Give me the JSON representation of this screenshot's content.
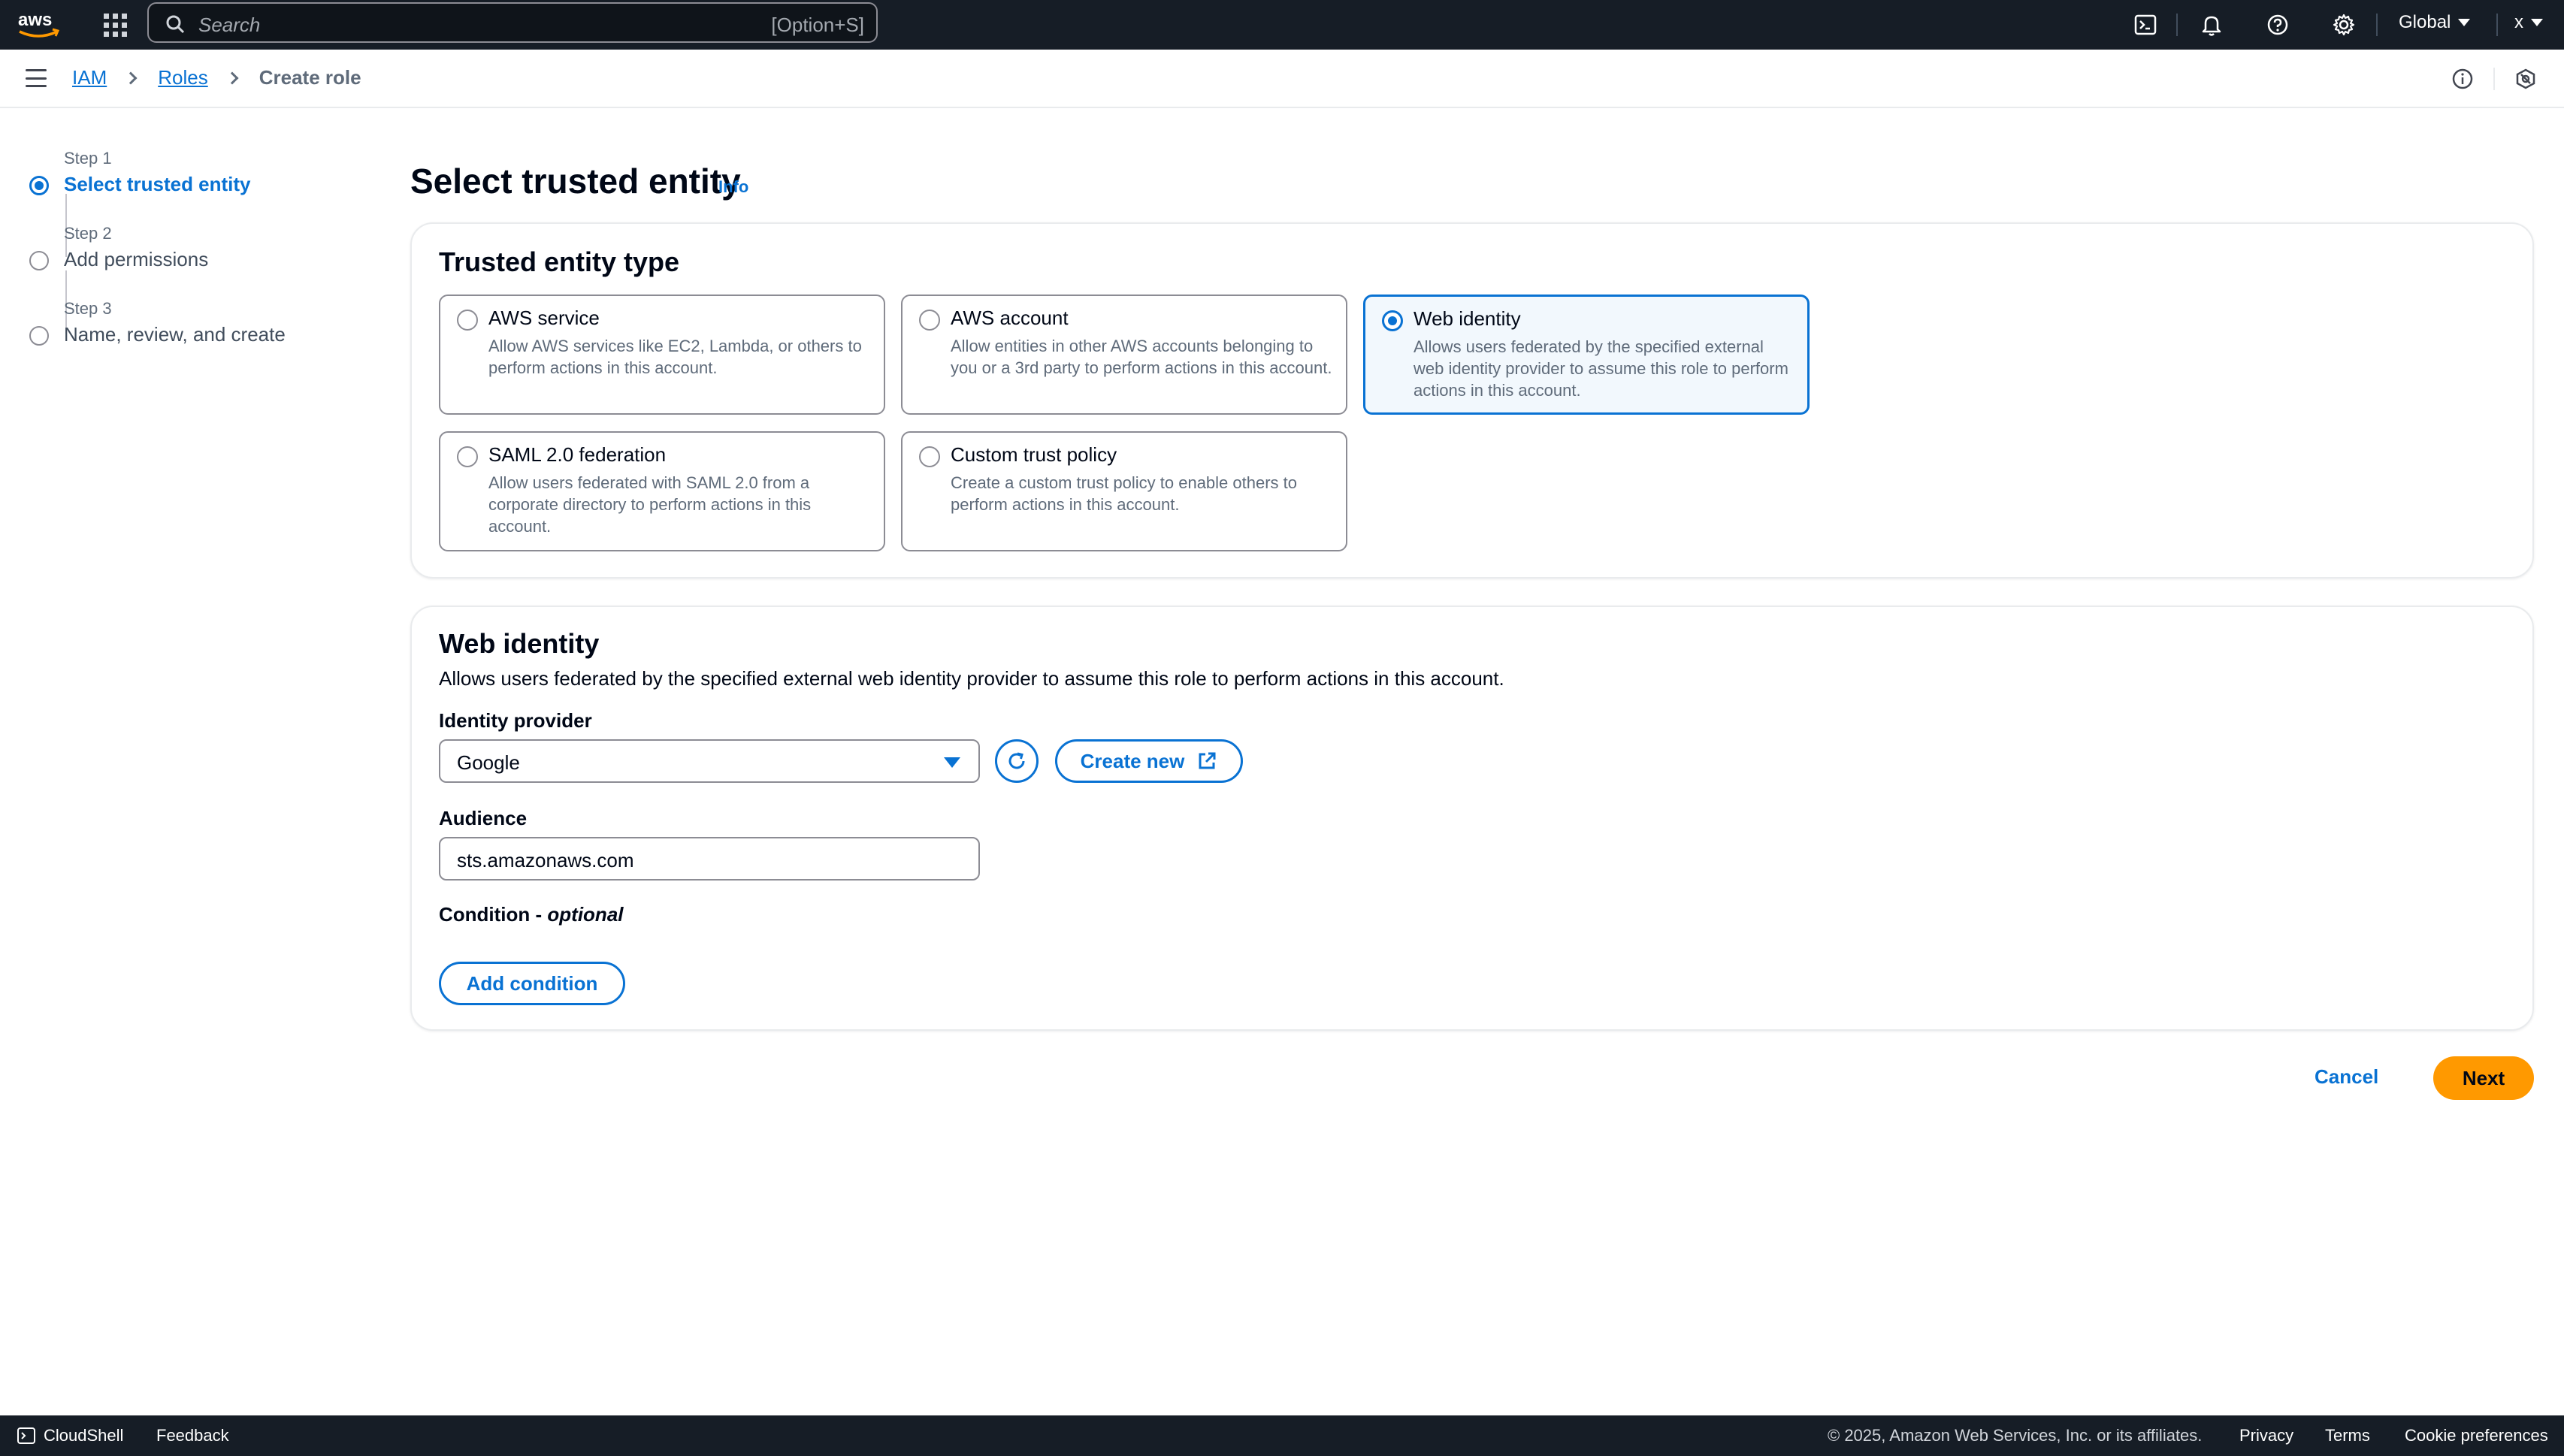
{
  "topnav": {
    "logo_text": "aws",
    "search_placeholder": "Search",
    "search_shortcut": "[Option+S]",
    "region": "Global",
    "account": "x"
  },
  "breadcrumb": {
    "items": [
      "IAM",
      "Roles"
    ],
    "current": "Create role"
  },
  "steps": [
    {
      "label": "Step 1",
      "title": "Select trusted entity",
      "active": true
    },
    {
      "label": "Step 2",
      "title": "Add permissions",
      "active": false
    },
    {
      "label": "Step 3",
      "title": "Name, review, and create",
      "active": false
    }
  ],
  "page": {
    "title": "Select trusted entity",
    "info": "Info"
  },
  "trusted_entity": {
    "heading": "Trusted entity type",
    "options": [
      {
        "title": "AWS service",
        "desc": "Allow AWS services like EC2, Lambda, or others to perform actions in this account.",
        "selected": false
      },
      {
        "title": "AWS account",
        "desc": "Allow entities in other AWS accounts belonging to you or a 3rd party to perform actions in this account.",
        "selected": false
      },
      {
        "title": "Web identity",
        "desc": "Allows users federated by the specified external web identity provider to assume this role to perform actions in this account.",
        "selected": true
      },
      {
        "title": "SAML 2.0 federation",
        "desc": "Allow users federated with SAML 2.0 from a corporate directory to perform actions in this account.",
        "selected": false
      },
      {
        "title": "Custom trust policy",
        "desc": "Create a custom trust policy to enable others to perform actions in this account.",
        "selected": false
      }
    ]
  },
  "web_identity": {
    "heading": "Web identity",
    "desc": "Allows users federated by the specified external web identity provider to assume this role to perform actions in this account.",
    "provider_label": "Identity provider",
    "provider_value": "Google",
    "create_new": "Create new",
    "audience_label": "Audience",
    "audience_value": "sts.amazonaws.com",
    "condition_label": "Condition - ",
    "condition_optional": "optional",
    "add_condition": "Add condition"
  },
  "actions": {
    "cancel": "Cancel",
    "next": "Next"
  },
  "footer": {
    "cloudshell": "CloudShell",
    "feedback": "Feedback",
    "copyright": "© 2025, Amazon Web Services, Inc. or its affiliates.",
    "privacy": "Privacy",
    "terms": "Terms",
    "cookies": "Cookie preferences"
  },
  "colors": {
    "nav_bg": "#161d26",
    "link_blue": "#0972d3",
    "primary_button": "#ff9900",
    "selected_tile_bg": "#f2f8fd"
  }
}
